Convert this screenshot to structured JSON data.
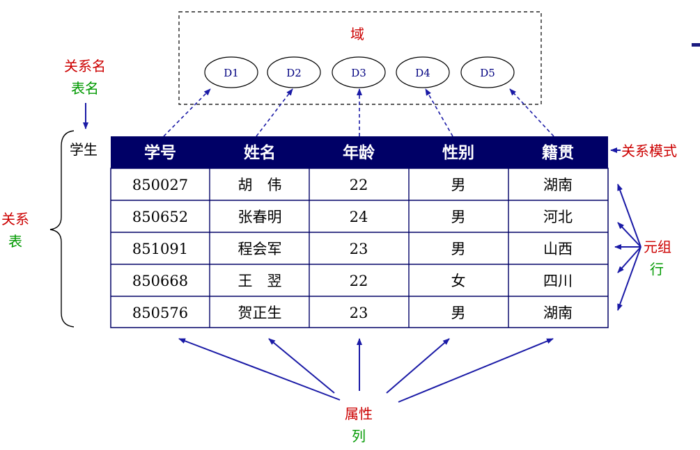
{
  "domain_box": {
    "label": "域",
    "domains": [
      "D1",
      "D2",
      "D3",
      "D4",
      "D5"
    ]
  },
  "labels": {
    "relation_name": "关系名",
    "table_name": "表名",
    "relation": "关系",
    "table": "表",
    "relation_schema": "关系模式",
    "tuple": "元组",
    "row": "行",
    "attribute": "属性",
    "column": "列"
  },
  "table": {
    "name": "学生",
    "headers": [
      "学号",
      "姓名",
      "年龄",
      "性别",
      "籍贯"
    ],
    "rows": [
      [
        "850027",
        "胡　伟",
        "22",
        "男",
        "湖南"
      ],
      [
        "850652",
        "张春明",
        "24",
        "男",
        "河北"
      ],
      [
        "851091",
        "程会军",
        "23",
        "男",
        "山西"
      ],
      [
        "850668",
        "王　翌",
        "22",
        "女",
        "四川"
      ],
      [
        "850576",
        "贺正生",
        "23",
        "男",
        "湖南"
      ]
    ]
  },
  "colors": {
    "header_bg": "#000066",
    "table_border": "#000066",
    "arrow": "#1a1aa6",
    "red_label": "#cc0000",
    "green_label": "#009900"
  }
}
